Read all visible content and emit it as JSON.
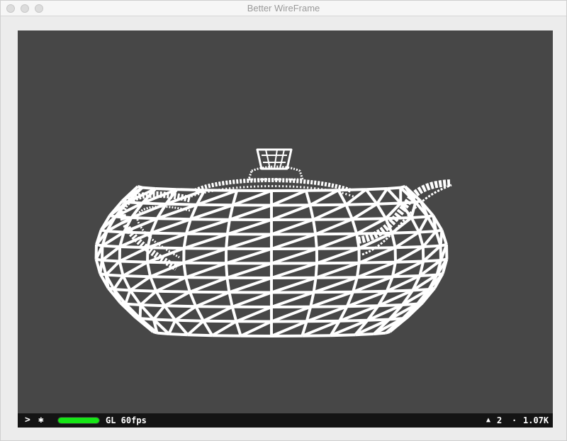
{
  "window": {
    "title": "Better WireFrame"
  },
  "status": {
    "chevron_glyph": ">",
    "gear_glyph": "✱",
    "meter_fraction": 1.0,
    "meter_color": "#16e616",
    "renderer_label": "GL 60fps",
    "triangle_glyph": "▲",
    "triangle_count": "2",
    "dot_glyph": "·",
    "vertex_count": "1.07K"
  },
  "colors": {
    "viewport_bg": "#474747",
    "wire": "#ffffff",
    "statusbar_bg": "#141414"
  },
  "icons": [
    "chevron-right-icon",
    "gear-icon",
    "triangle-icon",
    "dot-icon"
  ]
}
